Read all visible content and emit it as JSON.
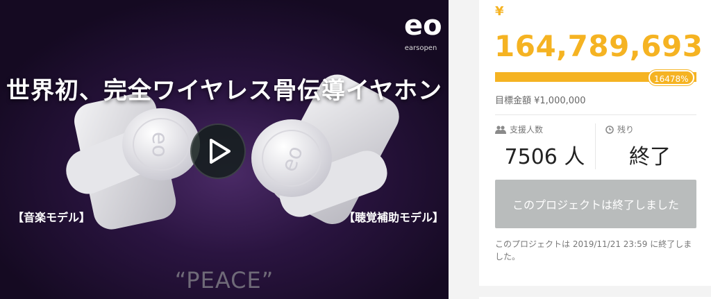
{
  "video": {
    "logo_text": "earsopen",
    "headline": "世界初、完全ワイヤレス骨伝導イヤホン",
    "model_left": "【音楽モデル】",
    "model_right": "【聴覚補助モデル】",
    "tagline": "“PEACE”",
    "play_icon": "play-icon"
  },
  "funding": {
    "currency_symbol": "¥",
    "raised": "164,789,693",
    "percent_text": "16478%",
    "progress": 1.0,
    "goal": "目標金額 ¥1,000,000",
    "accent_color": "#f5b322"
  },
  "stats": {
    "supporters_label": "支援人数",
    "supporters_value": "7506 人",
    "remaining_label": "残り",
    "remaining_value": "終了"
  },
  "status": {
    "button_label": "このプロジェクトは終了しました",
    "note": "このプロジェクトは 2019/11/21 23:59 に終了しました。"
  }
}
